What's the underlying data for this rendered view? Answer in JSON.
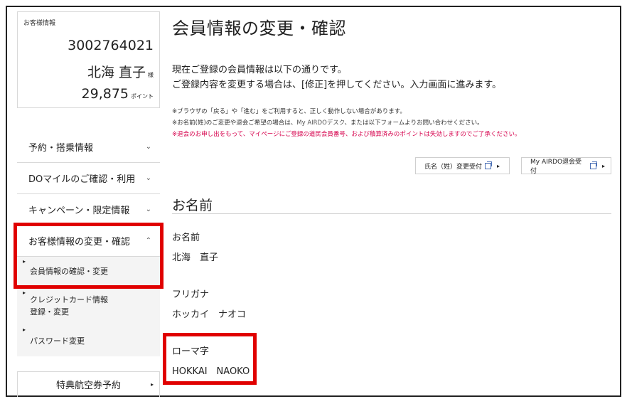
{
  "customer": {
    "label": "お客様情報",
    "number": "3002764021",
    "name": "北海 直子",
    "name_suffix": "様",
    "points": "29,875",
    "points_unit": "ポイント"
  },
  "sidebar": {
    "items": [
      {
        "label": "予約・搭乗情報"
      },
      {
        "label": "DOマイルのご確認・利用"
      },
      {
        "label": "キャンペーン・限定情報"
      },
      {
        "label": "お客様情報の変更・確認"
      }
    ],
    "sub_items": [
      {
        "label": "会員情報の確認・変更"
      },
      {
        "label_line1": "クレジットカード情報",
        "label_line2": "登録・変更"
      },
      {
        "label": "パスワード変更"
      }
    ],
    "ticket_button": "特典航空券予約"
  },
  "main": {
    "title": "会員情報の変更・確認",
    "intro_line1": "現在ご登録の会員情報は以下の通りです。",
    "intro_line2": "ご登録内容を変更する場合は、[修正]を押してください。入力画面に進みます。",
    "note1": "※ブラウザの「戻る」や「進む」をご利用すると、正しく動作しない場合があります。",
    "note2_a": "※お名前(姓)のご変更や退会ご希望の場合は、",
    "note2_link": "My AIRDOデスク",
    "note2_b": "、または以下フォームよりお問い合わせください。",
    "note3": "※退会のお申し出をもって、マイページにご登録の道民会員番号、および積算済みのポイントは失効しますのでご了承ください。",
    "btn_name_change": "氏名（姓）変更受付",
    "btn_withdraw": "My AIRDO退会受付",
    "section_title": "お名前",
    "fields": [
      {
        "label": "お名前",
        "value": "北海　直子"
      },
      {
        "label": "フリガナ",
        "value": "ホッカイ　ナオコ"
      },
      {
        "label": "ローマ字",
        "value": "HOKKAI　NAOKO"
      }
    ]
  },
  "colors": {
    "highlight_red": "#e00000",
    "warning_text": "#d6004c",
    "border": "#d9d9d9"
  }
}
